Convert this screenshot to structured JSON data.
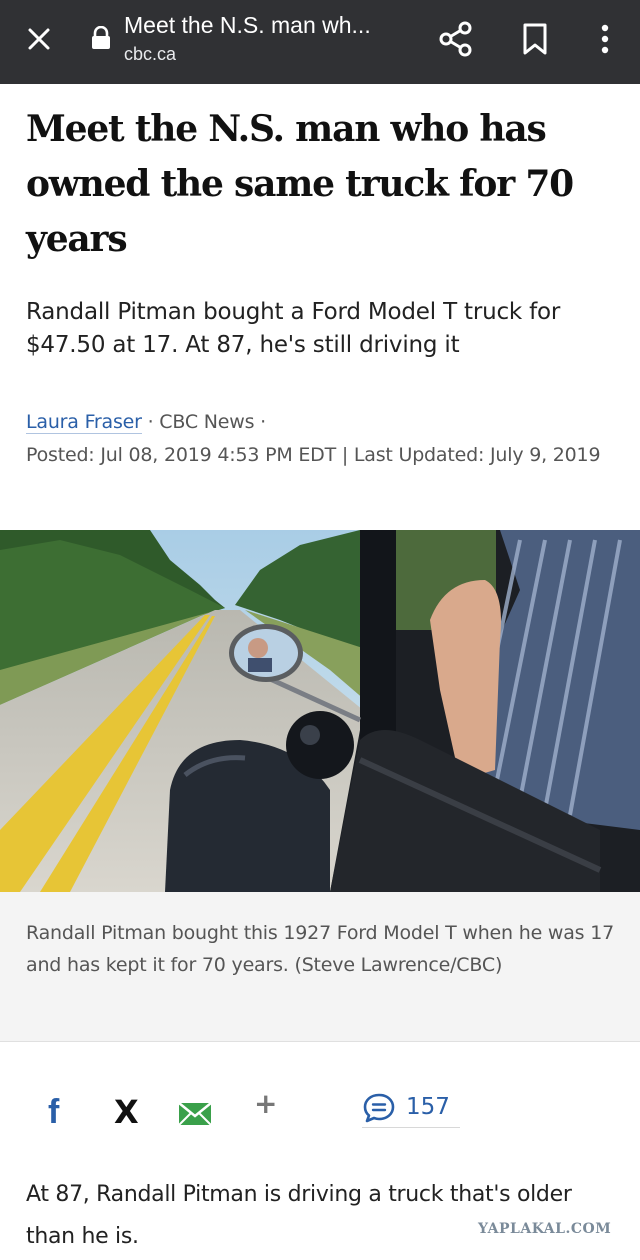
{
  "browser": {
    "tab_title": "Meet the N.S. man wh...",
    "domain": "cbc.ca",
    "icons": [
      "close-icon",
      "lock-icon",
      "share-icon",
      "bookmark-icon",
      "more-vert-icon"
    ],
    "bar_color": "#303134"
  },
  "article": {
    "headline": "Meet the N.S. man who has owned the same truck for 70 years",
    "deck": "Randall Pitman bought a Ford Model T truck for $47.50 at 17. At 87, he's still driving it",
    "byline": {
      "author": "Laura Fraser",
      "separator1": " · ",
      "outlet": "CBC News",
      "separator2": " · ",
      "posted": "Posted: Jul 08, 2019 4:53 PM EDT | Last Updated: July 9, 2019"
    },
    "photo_caption": "Randall Pitman bought this 1927 Ford Model T when he was 17 and has kept it for 70 years. (Steve Lawrence/CBC)",
    "first_paragraph": "At 87, Randall Pitman is driving a truck that's older than he is."
  },
  "share_bar": {
    "facebook_label": "f",
    "x_label": "X",
    "plus_label": "+",
    "comment_count": "157",
    "link_color": "#2a5fa8"
  },
  "watermark": "YAPLAKAL.COM"
}
